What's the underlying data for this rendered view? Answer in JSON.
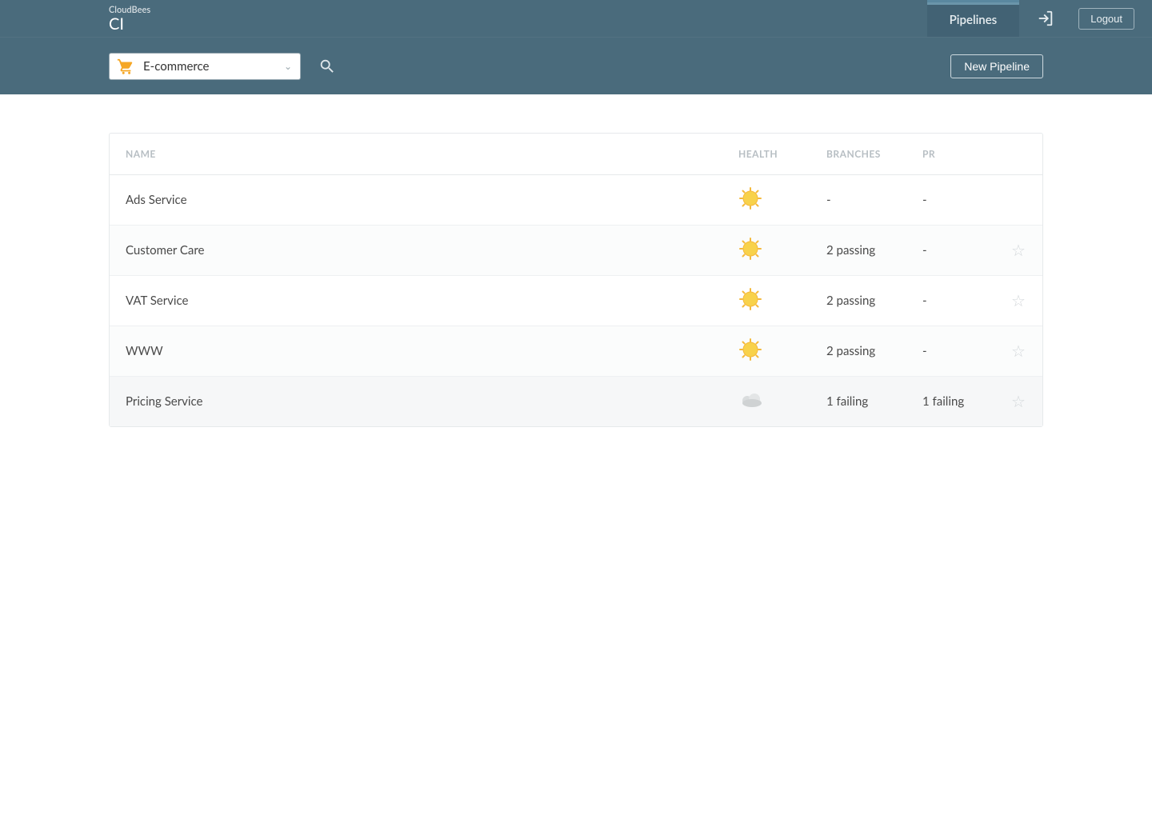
{
  "brand": {
    "top": "CloudBees",
    "bottom": "CI"
  },
  "nav": {
    "pipelines": "Pipelines",
    "logout": "Logout"
  },
  "subheader": {
    "project": "E-commerce",
    "new_pipeline": "New Pipeline"
  },
  "table": {
    "headers": {
      "name": "NAME",
      "health": "HEALTH",
      "branches": "BRANCHES",
      "pr": "PR"
    },
    "rows": [
      {
        "name": "Ads Service",
        "health": "sunny",
        "branches": "-",
        "pr": "-",
        "starred": null
      },
      {
        "name": "Customer Care",
        "health": "sunny",
        "branches": "2 passing",
        "pr": "-",
        "starred": false
      },
      {
        "name": "VAT Service",
        "health": "sunny",
        "branches": "2 passing",
        "pr": "-",
        "starred": false
      },
      {
        "name": "WWW",
        "health": "sunny",
        "branches": "2 passing",
        "pr": "-",
        "starred": false
      },
      {
        "name": "Pricing Service",
        "health": "cloud",
        "branches": "1 failing",
        "pr": "1 failing",
        "starred": false
      }
    ]
  }
}
